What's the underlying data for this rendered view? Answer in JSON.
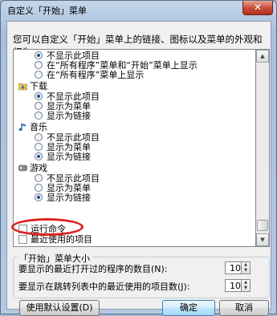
{
  "window": {
    "title": "自定义「开始」菜单",
    "close_glyph": "✕"
  },
  "description": "您可以自定义「开始」菜单上的链接、图标以及菜单的外观和行为。",
  "options": {
    "top": [
      {
        "label": "不显示此项目",
        "checked": true
      },
      {
        "label": "在“所有程序”菜单和“开始”菜单上显示",
        "checked": false
      },
      {
        "label": "在“所有程序”菜单上显示",
        "checked": false
      }
    ],
    "downloads": {
      "label": "下载",
      "icon": "downloads-folder-icon",
      "items": [
        {
          "label": "不显示此项目",
          "checked": true
        },
        {
          "label": "显示为菜单",
          "checked": false
        },
        {
          "label": "显示为链接",
          "checked": false
        }
      ]
    },
    "music": {
      "label": "音乐",
      "icon": "music-note-icon",
      "items": [
        {
          "label": "不显示此项目",
          "checked": false
        },
        {
          "label": "显示为菜单",
          "checked": false
        },
        {
          "label": "显示为链接",
          "checked": true
        }
      ]
    },
    "games": {
      "label": "游戏",
      "icon": "games-icon",
      "items": [
        {
          "label": "不显示此项目",
          "checked": false
        },
        {
          "label": "显示为菜单",
          "checked": false
        },
        {
          "label": "显示为链接",
          "checked": true
        }
      ]
    },
    "run_command": {
      "label": "运行命令",
      "checked": false
    },
    "recent_items": {
      "label": "最近使用的项目",
      "checked": false
    }
  },
  "start_menu_size": {
    "title": "「开始」菜单大小",
    "recent_programs_label": "要显示的最近打开过的程序的数目(N):",
    "recent_programs_value": "10",
    "jump_list_label": "要显示在跳转列表中的最近使用的项目数(J):",
    "jump_list_value": "10"
  },
  "buttons": {
    "defaults": "使用默认设置(D)",
    "ok": "确定",
    "cancel": "取消"
  },
  "colors": {
    "highlight_oval": "#e02020",
    "accent": "#3c7fb1"
  }
}
